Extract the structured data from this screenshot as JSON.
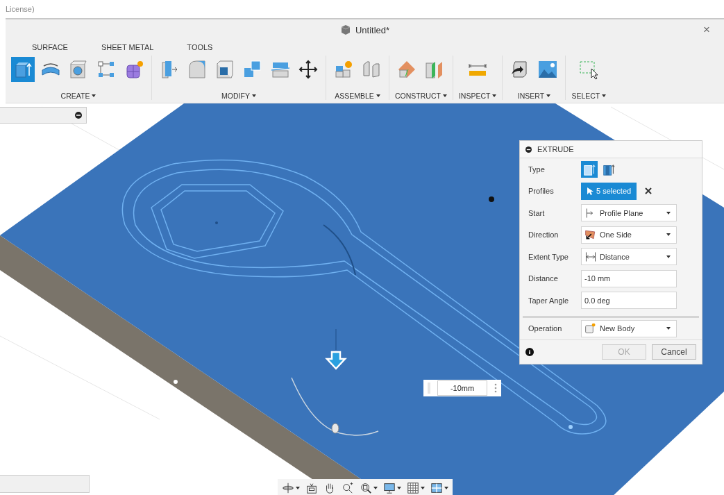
{
  "app_header": {
    "text": "License)"
  },
  "window": {
    "title": "Untitled*",
    "close": "×"
  },
  "tabs": [
    {
      "label": "SURFACE",
      "selected": false
    },
    {
      "label": "SHEET METAL",
      "selected": false
    },
    {
      "label": "TOOLS",
      "selected": false
    }
  ],
  "toolbar": [
    {
      "label": "CREATE",
      "tools": [
        {
          "kind": "extrude",
          "active": true
        },
        {
          "kind": "revolve",
          "active": false
        },
        {
          "kind": "hole",
          "active": false
        },
        {
          "kind": "pattern",
          "active": false
        },
        {
          "kind": "form",
          "active": false
        }
      ]
    },
    {
      "label": "MODIFY",
      "tools": [
        {
          "kind": "press-pull",
          "active": false
        },
        {
          "kind": "fillet",
          "active": false
        },
        {
          "kind": "shell",
          "active": false
        },
        {
          "kind": "combine",
          "active": false
        },
        {
          "kind": "split",
          "active": false
        },
        {
          "kind": "move",
          "active": false
        }
      ]
    },
    {
      "label": "ASSEMBLE",
      "tools": [
        {
          "kind": "new-component",
          "active": false
        },
        {
          "kind": "joint",
          "active": false
        }
      ]
    },
    {
      "label": "CONSTRUCT",
      "tools": [
        {
          "kind": "offset-plane",
          "active": false
        },
        {
          "kind": "midplane",
          "active": false
        }
      ]
    },
    {
      "label": "INSPECT",
      "tools": [
        {
          "kind": "measure",
          "active": false
        }
      ]
    },
    {
      "label": "INSERT",
      "tools": [
        {
          "kind": "insert-derive",
          "active": false
        },
        {
          "kind": "insert-image",
          "active": false
        }
      ]
    },
    {
      "label": "SELECT",
      "tools": [
        {
          "kind": "select-window",
          "active": false
        }
      ]
    }
  ],
  "dialog": {
    "title": "EXTRUDE",
    "rows": [
      {
        "kind": "toggle",
        "label": "Type",
        "options": [
          {
            "kind": "solid",
            "selected": true
          },
          {
            "kind": "thin",
            "selected": false
          }
        ]
      },
      {
        "kind": "selection",
        "label": "Profiles",
        "value": "5 selected"
      },
      {
        "kind": "dropdown",
        "label": "Start",
        "value": "Profile Plane"
      },
      {
        "kind": "dropdown",
        "label": "Direction",
        "value": "One Side"
      },
      {
        "kind": "dropdown",
        "label": "Extent Type",
        "value": "Distance"
      },
      {
        "kind": "input",
        "label": "Distance",
        "value": "-10 mm"
      },
      {
        "kind": "input",
        "label": "Taper Angle",
        "value": "0.0 deg"
      },
      {
        "kind": "dropdown",
        "label": "Operation",
        "value": "New Body",
        "separator_before": true
      }
    ],
    "buttons": [
      {
        "label": "OK",
        "disabled": true
      },
      {
        "label": "Cancel",
        "disabled": false
      }
    ]
  },
  "dimension": {
    "value": "-10mm"
  },
  "navigation": [
    {
      "kind": "orbit",
      "dropdown": true
    },
    {
      "kind": "look-at",
      "dropdown": false
    },
    {
      "kind": "pan",
      "dropdown": false
    },
    {
      "kind": "zoom",
      "dropdown": false
    },
    {
      "kind": "fit",
      "dropdown": true
    },
    {
      "kind": "display",
      "dropdown": true
    },
    {
      "kind": "grid",
      "dropdown": true
    },
    {
      "kind": "viewports",
      "dropdown": true
    }
  ]
}
